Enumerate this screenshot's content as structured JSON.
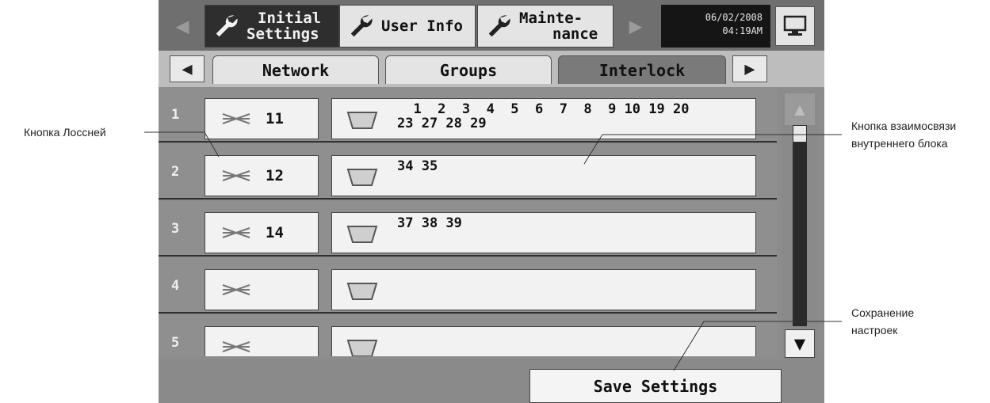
{
  "topbar": {
    "tabs": [
      {
        "line1": "Initial",
        "line2": "Settings",
        "icon": "wrench-icon",
        "active": true
      },
      {
        "line1": "User Info",
        "line2": "",
        "icon": "wrench-icon",
        "active": false
      },
      {
        "line1": "Mainte-",
        "line2": "nance",
        "icon": "wrench-icon",
        "active": false
      }
    ],
    "date": "06/02/2008",
    "time": "04:19AM"
  },
  "subtabs": {
    "items": [
      "Network",
      "Groups",
      "Interlock"
    ],
    "active": "Interlock"
  },
  "rows": [
    {
      "num": "1",
      "lossnay": "11",
      "addr_line1": "  1  2  3  4  5  6  7  8  9 10 19 20",
      "addr_line2": "23 27 28 29"
    },
    {
      "num": "2",
      "lossnay": "12",
      "addr_line1": "34 35",
      "addr_line2": ""
    },
    {
      "num": "3",
      "lossnay": "14",
      "addr_line1": "37 38 39",
      "addr_line2": ""
    },
    {
      "num": "4",
      "lossnay": "",
      "addr_line1": "",
      "addr_line2": ""
    },
    {
      "num": "5",
      "lossnay": "",
      "addr_line1": "",
      "addr_line2": ""
    }
  ],
  "save_button": "Save Settings",
  "annotations": {
    "lossnay_button": "Кнопка Лоссней",
    "interlock_line1": "Кнопка взаимосвязи",
    "interlock_line2": "внутреннего блока",
    "save_line1": "Сохранение",
    "save_line2": "настроек"
  },
  "colors": {
    "active_tab": "#2e2e2e",
    "panel": "#8f8f8f",
    "button": "#f2f2f2"
  }
}
